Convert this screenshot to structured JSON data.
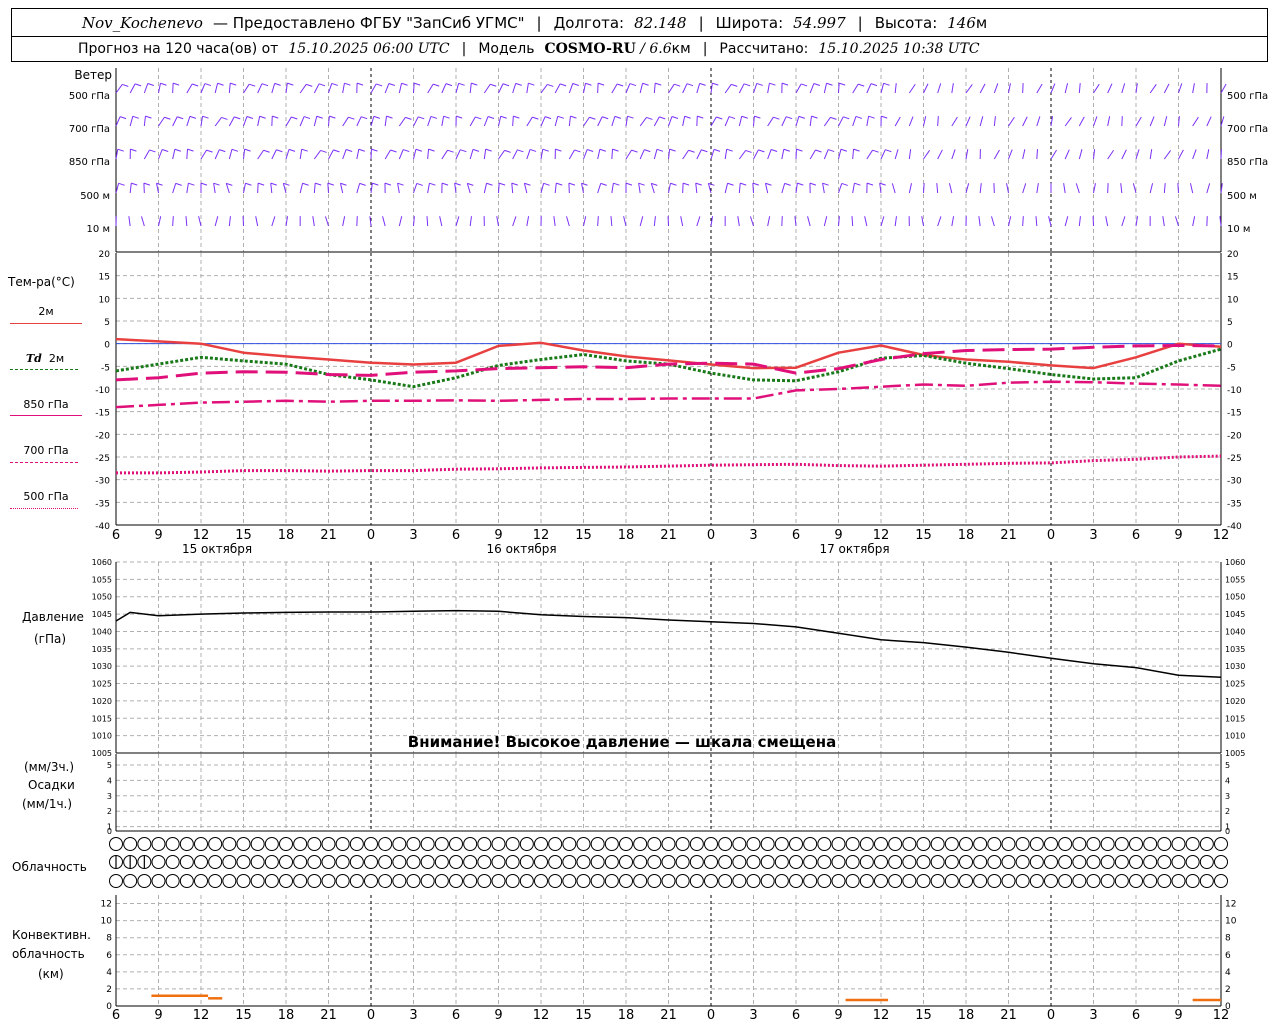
{
  "header": {
    "station": "Nov_Kochenevo",
    "provider": "— Предоставлено ФГБУ \"ЗапСиб УГМС\"",
    "lon_label": "Долгота:",
    "lon_value": "82.148",
    "lat_label": "Широта:",
    "lat_value": "54.997",
    "alt_label": "Высота:",
    "alt_value": "146",
    "alt_unit": "м",
    "forecast_prefix": "Прогноз на 120 часа(ов) от",
    "forecast_time": "15.10.2025 06:00 UTC",
    "model_label": "Модель",
    "model_name": "COSMO-RU",
    "model_res": "/ 6.6",
    "model_unit": "км",
    "calc_label": "Рассчитано:",
    "calc_time": "15.10.2025 10:38 UTC"
  },
  "labels": {
    "wind": "Ветер",
    "temp": "Тем-ра(°С)",
    "pressure": "Давление",
    "pressure_unit": "(гПа)",
    "precip_unit1": "(мм/3ч.)",
    "precip": "Осадки",
    "precip_unit2": "(мм/1ч.)",
    "cloud": "Облачность",
    "conv1": "Конвективн.",
    "conv2": "облачность",
    "conv3": "(км)",
    "warning": "Внимание! Высокое давление — шкала смещена"
  },
  "legend": {
    "t2m": "2м",
    "td_prefix": "Td",
    "td2m": "2м",
    "t850": "850 гПа",
    "t700": "700 гПа",
    "t500": "500 гПа"
  },
  "colors": {
    "wind": "#7b2ff7",
    "t2m": "#e84040",
    "td2m": "#1a7a1a",
    "t850": "#e0107a",
    "t700": "#e0107a",
    "t500": "#e0107a",
    "zero": "#3050e0",
    "pressure": "#000000",
    "conv": "#f07010",
    "grid": "#b0b0b0"
  },
  "chart_data": [
    {
      "type": "line",
      "name_panel": "wind",
      "levels": [
        "500 гПа",
        "700 гПа",
        "850 гПа",
        "500 м",
        "10 м"
      ],
      "x_ticks": [
        "6",
        "9",
        "12",
        "15",
        "18",
        "21",
        "0",
        "3",
        "6",
        "9",
        "12",
        "15",
        "18",
        "21",
        "0",
        "3",
        "6",
        "9",
        "12",
        "15",
        "18",
        "21",
        "0",
        "3",
        "6",
        "9",
        "12"
      ]
    },
    {
      "type": "line",
      "name_panel": "temperature",
      "ylim": [
        -40,
        20
      ],
      "y_ticks": [
        20,
        15,
        10,
        5,
        0,
        -5,
        -10,
        -15,
        -20,
        -25,
        -30,
        -35,
        -40
      ],
      "x": [
        0,
        3,
        6,
        9,
        12,
        15,
        18,
        21,
        24,
        27,
        30,
        33,
        36,
        39,
        42,
        45,
        48,
        51,
        54,
        57,
        60,
        63,
        66,
        69,
        72,
        75,
        78
      ],
      "x_ticks": [
        "6",
        "9",
        "12",
        "15",
        "18",
        "21",
        "0",
        "3",
        "6",
        "9",
        "12",
        "15",
        "18",
        "21",
        "0",
        "3",
        "6",
        "9",
        "12",
        "15",
        "18",
        "21",
        "0",
        "3",
        "6",
        "9",
        "12"
      ],
      "dates": [
        "15 октября",
        "16 октября",
        "17 октября"
      ],
      "series": [
        {
          "key": "t2m",
          "values": [
            1.0,
            0.5,
            0.0,
            -2.0,
            -2.8,
            -3.5,
            -4.2,
            -4.6,
            -4.2,
            -0.5,
            0.2,
            -1.5,
            -2.8,
            -3.7,
            -4.6,
            -5.4,
            -5.3,
            -2.0,
            -0.4,
            -2.5,
            -3.5,
            -4.0,
            -4.8,
            -5.4,
            -3.0,
            0.0,
            -0.7
          ]
        },
        {
          "key": "td2m",
          "values": [
            -6.0,
            -4.5,
            -3.0,
            -3.8,
            -4.5,
            -6.8,
            -8.0,
            -9.5,
            -7.5,
            -4.8,
            -3.5,
            -2.4,
            -3.8,
            -4.5,
            -6.5,
            -8.0,
            -8.2,
            -6.2,
            -3.2,
            -2.6,
            -4.3,
            -5.5,
            -6.8,
            -7.8,
            -7.5,
            -3.8,
            -1.2
          ]
        },
        {
          "key": "t850",
          "values": [
            -8.0,
            -7.5,
            -6.5,
            -6.2,
            -6.3,
            -6.8,
            -7.0,
            -6.3,
            -6.0,
            -5.5,
            -5.3,
            -5.1,
            -5.3,
            -4.5,
            -4.3,
            -4.5,
            -6.5,
            -5.5,
            -3.5,
            -2.2,
            -1.5,
            -1.3,
            -1.2,
            -0.8,
            -0.5,
            -0.4,
            -0.5
          ]
        },
        {
          "key": "t700",
          "values": [
            -14.0,
            -13.5,
            -13.0,
            -12.8,
            -12.6,
            -12.8,
            -12.6,
            -12.6,
            -12.5,
            -12.6,
            -12.4,
            -12.2,
            -12.2,
            -12.1,
            -12.1,
            -12.1,
            -10.3,
            -10.0,
            -9.5,
            -9.0,
            -9.3,
            -8.6,
            -8.4,
            -8.5,
            -8.8,
            -9.0,
            -9.3
          ]
        },
        {
          "key": "t500",
          "values": [
            -28.5,
            -28.5,
            -28.3,
            -28.0,
            -28.0,
            -28.1,
            -28.0,
            -28.0,
            -27.7,
            -27.6,
            -27.4,
            -27.3,
            -27.2,
            -27.0,
            -26.8,
            -26.7,
            -26.6,
            -26.9,
            -27.0,
            -26.8,
            -26.6,
            -26.4,
            -26.3,
            -25.8,
            -25.5,
            -25.0,
            -24.8
          ]
        }
      ]
    },
    {
      "type": "line",
      "name_panel": "pressure",
      "ylim": [
        1005,
        1060
      ],
      "y_ticks": [
        1060,
        1055,
        1050,
        1045,
        1040,
        1035,
        1030,
        1025,
        1020,
        1015,
        1010,
        1005
      ],
      "x": [
        0,
        1,
        3,
        6,
        9,
        12,
        15,
        18,
        21,
        24,
        27,
        30,
        33,
        36,
        39,
        42,
        45,
        48,
        51,
        54,
        57,
        60,
        63,
        66,
        69,
        72,
        75,
        78
      ],
      "values": [
        1043.0,
        1045.5,
        1044.5,
        1045.0,
        1045.3,
        1045.5,
        1045.6,
        1045.6,
        1045.8,
        1046.0,
        1045.8,
        1044.8,
        1044.3,
        1044.0,
        1043.3,
        1042.8,
        1042.3,
        1041.3,
        1039.5,
        1037.6,
        1036.8,
        1035.5,
        1034.0,
        1032.3,
        1030.7,
        1029.6,
        1027.4,
        1026.8
      ]
    },
    {
      "type": "bar",
      "name_panel": "precipitation",
      "ylim": [
        0,
        5
      ],
      "y_ticks": [
        5,
        4,
        3,
        2,
        1,
        0
      ],
      "x": [
        0,
        3,
        6,
        9,
        12,
        15,
        18,
        21,
        24,
        27,
        30,
        33,
        36,
        39,
        42,
        45,
        48,
        51,
        54,
        57,
        60,
        63,
        66,
        69,
        72,
        75,
        78
      ],
      "values": [
        0,
        0,
        0,
        0,
        0,
        0,
        0,
        0,
        0,
        0,
        0,
        0,
        0,
        0,
        0,
        0,
        0,
        0,
        0,
        0,
        0,
        0,
        0,
        0,
        0,
        0,
        0
      ]
    },
    {
      "type": "bar",
      "name_panel": "convective_cloud",
      "ylim": [
        0,
        13
      ],
      "y_ticks": [
        12,
        10,
        8,
        6,
        4,
        2,
        0
      ],
      "x_ticks": [
        "6",
        "9",
        "12",
        "15",
        "18",
        "21",
        "0",
        "3",
        "6",
        "9",
        "12",
        "15",
        "18",
        "21",
        "0",
        "3",
        "6",
        "9",
        "12",
        "15",
        "18",
        "21",
        "0",
        "3",
        "6",
        "9",
        "12"
      ],
      "segments": [
        {
          "x_start": 2.5,
          "x_end": 6.5,
          "height": 1.2
        },
        {
          "x_start": 6.5,
          "x_end": 7.5,
          "height": 0.9
        },
        {
          "x_start": 51.5,
          "x_end": 54.5,
          "height": 0.7
        },
        {
          "x_start": 76.0,
          "x_end": 78.0,
          "height": 0.7
        }
      ]
    }
  ]
}
